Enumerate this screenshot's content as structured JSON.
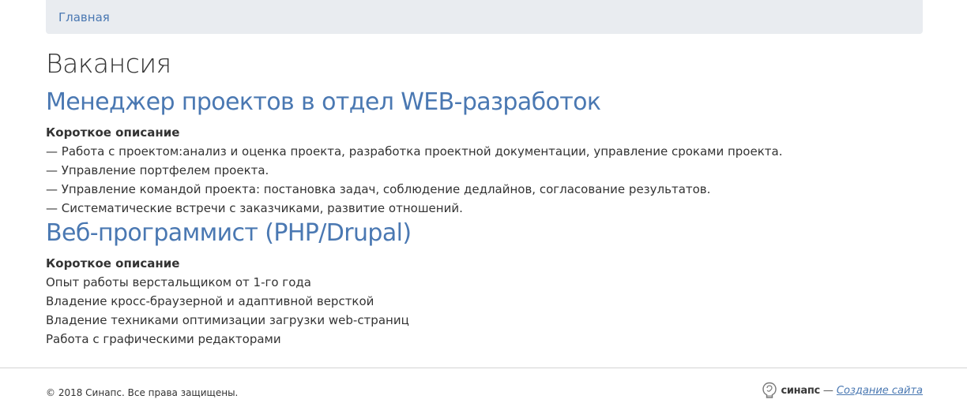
{
  "breadcrumb": {
    "home_label": "Главная"
  },
  "page": {
    "title": "Вакансия"
  },
  "vacancies": [
    {
      "title": "Менеджер проектов в отдел WEB-разработок",
      "desc_heading": "Короткое описание",
      "lines": [
        "— Работа с проектом:анализ и оценка проекта, разработка проектной документации, управление сроками проекта.",
        "— Управление портфелем проекта.",
        "— Управление командой проекта: постановка задач, соблюдение дедлайнов, согласование результатов.",
        "— Систематические встречи с заказчиками, развитие отношений."
      ]
    },
    {
      "title": "Веб-программист (PHP/Drupal)",
      "desc_heading": "Короткое описание",
      "lines": [
        "Опыт работы верстальщиком от 1-го года",
        "Владение кросс-браузерной и адаптивной версткой",
        "Владение техниками оптимизации загрузки web-страниц",
        "Работа с графическими редакторами"
      ]
    }
  ],
  "footer": {
    "copyright": "© 2018 Синапс. Все права защищены.",
    "brand": "синапс",
    "dash": "—",
    "credit_link": "Создание сайта",
    "logo_icon": "synapse-logo-icon"
  },
  "colors": {
    "link": "#4a78b2",
    "breadcrumb_bg": "#e9ecf0",
    "text": "#333333"
  }
}
